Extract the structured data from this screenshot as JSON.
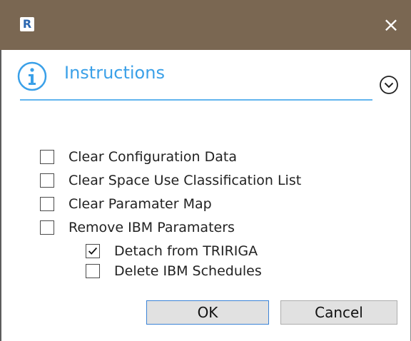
{
  "titlebar": {
    "app_icon_letter": "R",
    "close_glyph": "×",
    "background_color": "#7a6752"
  },
  "header": {
    "title": "Instructions",
    "info_icon": "info-icon",
    "expand_icon": "chevron-down-icon",
    "accent_color": "#3aa0e8"
  },
  "options": [
    {
      "label": "Clear Configuration Data",
      "checked": false
    },
    {
      "label": "Clear Space Use Classification List",
      "checked": false
    },
    {
      "label": "Clear Paramater Map",
      "checked": false
    },
    {
      "label": "Remove IBM Paramaters",
      "checked": false
    }
  ],
  "sub_options": [
    {
      "label": "Detach from TRIRIGA",
      "checked": true
    },
    {
      "label": "Delete IBM Schedules",
      "checked": false
    }
  ],
  "buttons": {
    "ok_label": "OK",
    "cancel_label": "Cancel"
  }
}
